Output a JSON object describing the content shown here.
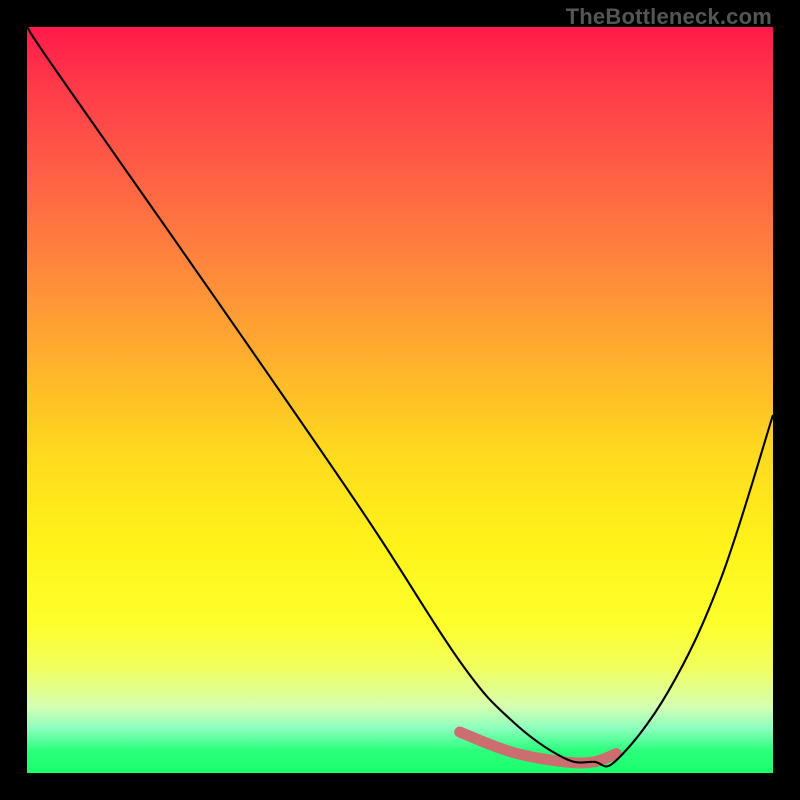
{
  "watermark": "TheBottleneck.com",
  "colors": {
    "frame": "#000000",
    "gradient_top": "#ff1a4a",
    "gradient_mid": "#ffdc1e",
    "gradient_bottom": "#1aff6c",
    "curve": "#000000",
    "valley_highlight": "#cc6e70"
  },
  "chart_data": {
    "type": "line",
    "title": "",
    "xlabel": "",
    "ylabel": "",
    "xlim": [
      0,
      100
    ],
    "ylim": [
      0,
      100
    ],
    "series": [
      {
        "name": "bottleneck-curve",
        "x": [
          0,
          4,
          25,
          45,
          58,
          65,
          72,
          76,
          79,
          86,
          93,
          100
        ],
        "values": [
          100,
          94,
          64,
          35,
          15,
          7,
          2,
          1.5,
          1.7,
          11,
          26,
          48
        ]
      }
    ],
    "valley_highlight": {
      "x": [
        58,
        65,
        72,
        76,
        79
      ],
      "values": [
        5.5,
        2.8,
        1.5,
        1.5,
        2.6
      ]
    }
  }
}
